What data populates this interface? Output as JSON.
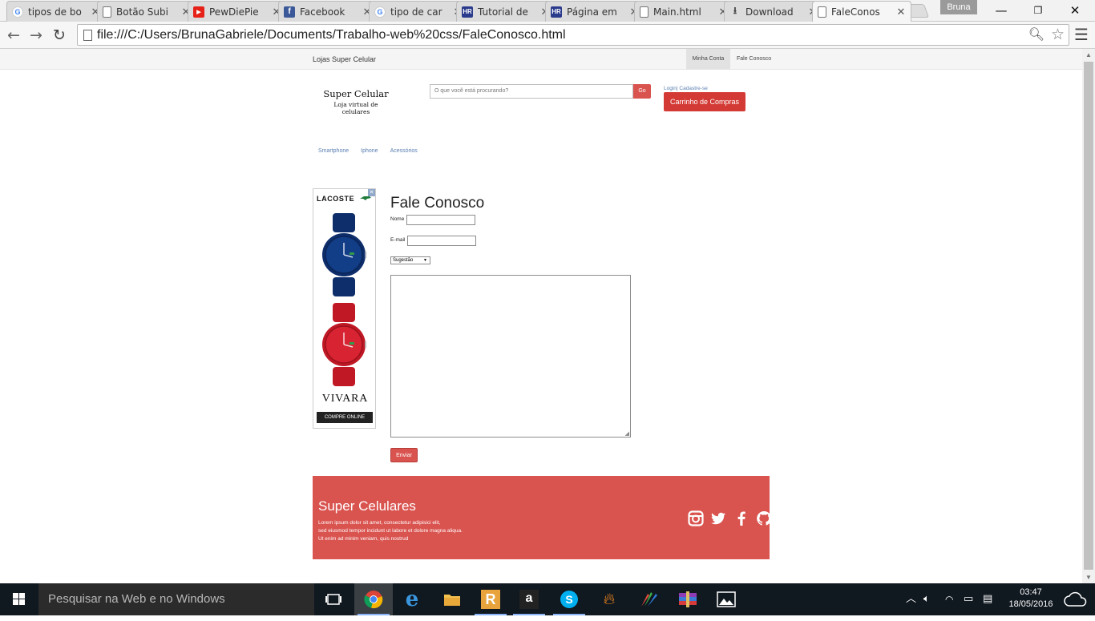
{
  "browser": {
    "tabs": [
      {
        "title": "tipos de bo",
        "favicon": "google-icon"
      },
      {
        "title": "Botão Subi",
        "favicon": "document-icon"
      },
      {
        "title": "PewDiePie",
        "favicon": "youtube-icon"
      },
      {
        "title": "Facebook",
        "favicon": "facebook-icon"
      },
      {
        "title": "tipo de car",
        "favicon": "google-icon"
      },
      {
        "title": "Tutorial de",
        "favicon": "hr-icon"
      },
      {
        "title": "Página em",
        "favicon": "hr-icon"
      },
      {
        "title": "Main.html",
        "favicon": "document-icon"
      },
      {
        "title": "Download",
        "favicon": "download-icon"
      },
      {
        "title": "FaleConos",
        "favicon": "document-icon",
        "active": true
      }
    ],
    "profile_name": "Bruna",
    "url": "file:///C:/Users/BrunaGabriele/Documents/Trabalho-web%20css/FaleConosco.html"
  },
  "site": {
    "topbar": {
      "brand": "Lojas Super Celular",
      "minha_conta": "Minha Conta",
      "fale_conosco": "Fale Conosco"
    },
    "logo": {
      "title": "Super Celular",
      "subtitle": "Loja virtual de celulares"
    },
    "search": {
      "placeholder": "O que você está procurando?",
      "go": "Go"
    },
    "login_text": "Login| Cadastre-se",
    "cart_label": "Carrinho de Compras",
    "categories": [
      "Smartphone",
      "Iphone",
      "Acessórios"
    ],
    "ad": {
      "brand": "LACOSTE",
      "store": "VIVARA",
      "cta": "COMPRE ONLINE",
      "close_glyph": "✕"
    },
    "form": {
      "title": "Fale Conosco",
      "name_label": "Nome",
      "email_label": "E-mail",
      "select_value": "Sugestão",
      "submit": "Enviar"
    },
    "footer": {
      "title": "Super Celulares",
      "text_lines": [
        "Lorem ipsum dolor sit amet, consectetur adipisici elit,",
        "sed eiusmod tempor incidunt ut labore et dolore magna aliqua.",
        "Ut enim ad minim veniam, quis nostrud"
      ],
      "social_icons": [
        "instagram-icon",
        "twitter-icon",
        "facebook-icon",
        "github-icon"
      ]
    },
    "colors": {
      "accent": "#d9534f",
      "cart": "#d43a35",
      "link": "#5b7fb2"
    }
  },
  "taskbar": {
    "search_placeholder": "Pesquisar na Web e no Windows",
    "time": "03:47",
    "date": "18/05/2016",
    "apps": [
      "task-view-icon",
      "chrome-icon",
      "edge-icon",
      "file-explorer-icon",
      "r-app-icon",
      "amazon-icon",
      "skype-icon",
      "flame-app-icon",
      "paint-app-icon",
      "archive-app-icon",
      "photos-icon"
    ]
  }
}
